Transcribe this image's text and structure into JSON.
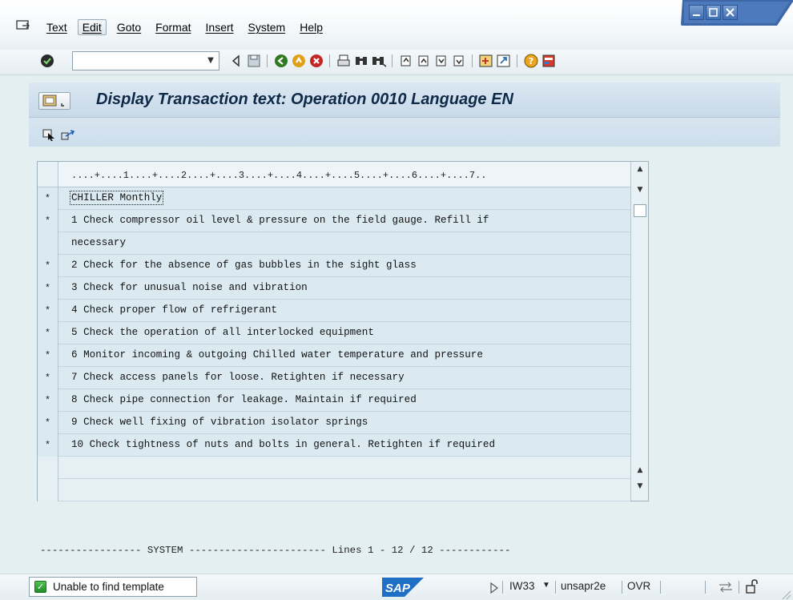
{
  "menubar": {
    "items": [
      "Text",
      "Edit",
      "Goto",
      "Format",
      "Insert",
      "System",
      "Help"
    ],
    "active_item": "Edit"
  },
  "toolbar": {
    "command_field_value": "",
    "icons": [
      "enter-icon",
      "back-arrow-icon",
      "save-icon",
      "back-icon",
      "exit-icon",
      "cancel-icon",
      "print-icon",
      "find-icon",
      "find-next-icon",
      "first-page-icon",
      "previous-page-icon",
      "next-page-icon",
      "last-page-icon",
      "create-session-icon",
      "shortcut-icon",
      "help-icon",
      "layout-icon"
    ]
  },
  "title": {
    "text": "Display Transaction text: Operation 0010 Language EN"
  },
  "editor": {
    "ruler": "....+....1....+....2....+....3....+....4....+....5....+....6....+....7..",
    "rows": [
      {
        "fmt": "*",
        "text": "CHILLER Monthly"
      },
      {
        "fmt": "*",
        "text": "1 Check compressor oil level & pressure on the field gauge. Refill if"
      },
      {
        "fmt": "",
        "text": "necessary"
      },
      {
        "fmt": "*",
        "text": "2 Check for the absence of gas bubbles in the sight glass"
      },
      {
        "fmt": "*",
        "text": "3 Check for unusual noise and vibration"
      },
      {
        "fmt": "*",
        "text": "4 Check proper flow of refrigerant"
      },
      {
        "fmt": "*",
        "text": "5 Check the operation of all interlocked equipment"
      },
      {
        "fmt": "*",
        "text": "6 Monitor incoming & outgoing Chilled water temperature and pressure"
      },
      {
        "fmt": "*",
        "text": "7 Check access panels for loose. Retighten if necessary"
      },
      {
        "fmt": "*",
        "text": "8 Check pipe connection for leakage. Maintain if required"
      },
      {
        "fmt": "*",
        "text": "9 Check well fixing of vibration isolator springs"
      },
      {
        "fmt": "*",
        "text": "10 Check tightness of nuts and bolts in general. Retighten if required"
      },
      {
        "fmt": "",
        "text": ""
      },
      {
        "fmt": "",
        "text": ""
      }
    ],
    "system_line": "----------------- SYSTEM ----------------------- Lines 1 - 12 / 12 ------------"
  },
  "statusbar": {
    "message": "Unable to find template",
    "logo": "SAP",
    "transaction": "IW33",
    "server": "unsapr2e",
    "mode": "OVR"
  },
  "colors": {
    "title_text": "#0e2a48",
    "background": "#e4eff1",
    "editor_bg": "#dbeaf1",
    "sap_blue": "#1f6fc5"
  }
}
